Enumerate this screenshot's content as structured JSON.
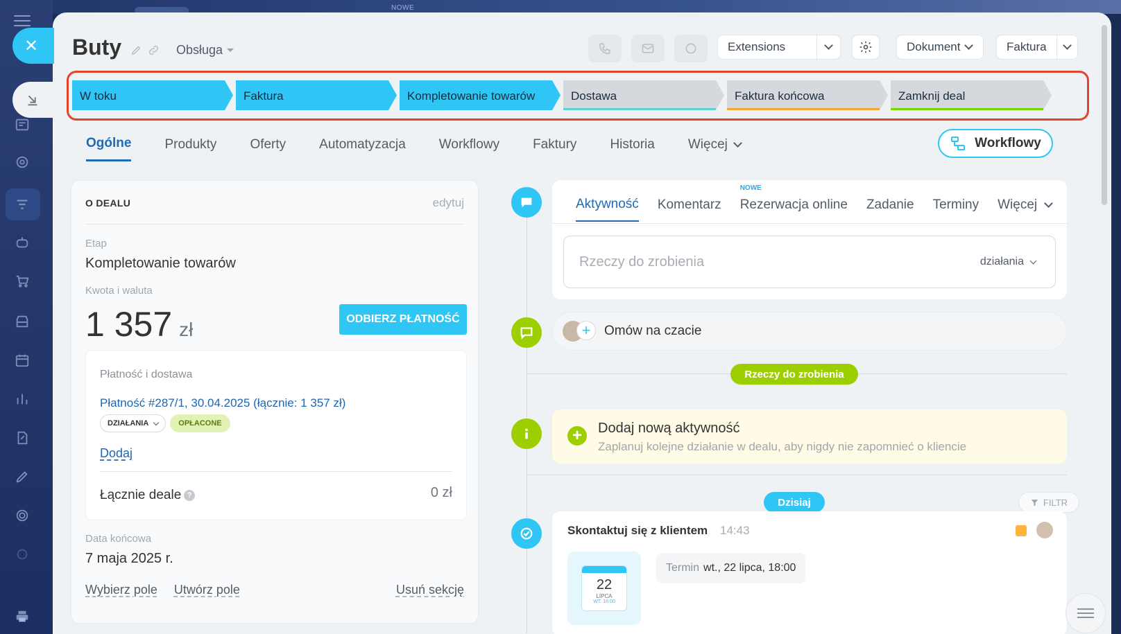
{
  "background": {
    "top_badge": "NOWE"
  },
  "header": {
    "title": "Buty",
    "category": "Obsługa",
    "extensions_label": "Extensions",
    "dokument_label": "Dokument",
    "faktura_label": "Faktura"
  },
  "stages": [
    {
      "label": "W toku",
      "state": "done",
      "color": "#2fc6f6"
    },
    {
      "label": "Faktura",
      "state": "done",
      "color": "#2fc6f6"
    },
    {
      "label": "Kompletowanie towarów",
      "state": "current",
      "color": "#2fc6f6"
    },
    {
      "label": "Dostawa",
      "state": "pending",
      "color": "#5ad4cc"
    },
    {
      "label": "Faktura końcowa",
      "state": "pending",
      "color": "#f4a734"
    },
    {
      "label": "Zamknij deal",
      "state": "pending",
      "color": "#7bd500"
    }
  ],
  "tabs": [
    {
      "label": "Ogólne",
      "active": true
    },
    {
      "label": "Produkty"
    },
    {
      "label": "Oferty"
    },
    {
      "label": "Automatyzacja"
    },
    {
      "label": "Workflowy"
    },
    {
      "label": "Faktury"
    },
    {
      "label": "Historia"
    },
    {
      "label": "Więcej"
    }
  ],
  "workflow_button": "Workflowy",
  "deal_card": {
    "heading": "O DEALU",
    "edit": "edytuj",
    "stage_label": "Etap",
    "stage_value": "Kompletowanie towarów",
    "amount_label": "Kwota i waluta",
    "amount_value": "1 357",
    "amount_currency": "zł",
    "pay_button": "ODBIERZ PŁATNOŚĆ",
    "payment_section_title": "Płatność i dostawa",
    "payment_link": "Płatność #287/1, 30.04.2025 (łącznie: 1 357 zł)",
    "actions_badge": "DZIAŁANIA",
    "paid_badge": "OPŁACONE",
    "add_link": "Dodaj",
    "total_label": "Łącznie deale",
    "total_value": "0 zł",
    "end_date_label": "Data końcowa",
    "end_date_value": "7 maja 2025 r.",
    "select_field": "Wybierz pole",
    "create_field": "Utwórz pole",
    "delete_section": "Usuń sekcję"
  },
  "activity": {
    "new_badge": "NOWE",
    "tabs": [
      {
        "label": "Aktywność",
        "active": true
      },
      {
        "label": "Komentarz"
      },
      {
        "label": "Rezerwacja online"
      },
      {
        "label": "Zadanie"
      },
      {
        "label": "Terminy"
      },
      {
        "label": "Więcej"
      }
    ],
    "todo_placeholder": "Rzeczy do zrobienia",
    "todo_actions": "działania",
    "chat_text": "Omów na czacie",
    "todo_pill": "Rzeczy do zrobienia",
    "new_activity_title": "Dodaj nową aktywność",
    "new_activity_hint": "Zaplanuj kolejne działanie w dealu, aby nigdy nie zapomnieć o kliencie",
    "today_pill": "Dzisiaj",
    "filter": "FILTR",
    "task_title": "Skontaktuj się z klientem",
    "task_time": "14:43",
    "calendar_day": "22",
    "calendar_month": "LIPCA",
    "calendar_weekday": "WT. 18:00",
    "termin_label": "Termin",
    "termin_value": "wt., 22 lipca, 18:00"
  },
  "colors": {
    "accent": "#2fc6f6",
    "link": "#2066b0",
    "highlight_frame": "#e0442b",
    "green": "#9dcf00"
  }
}
